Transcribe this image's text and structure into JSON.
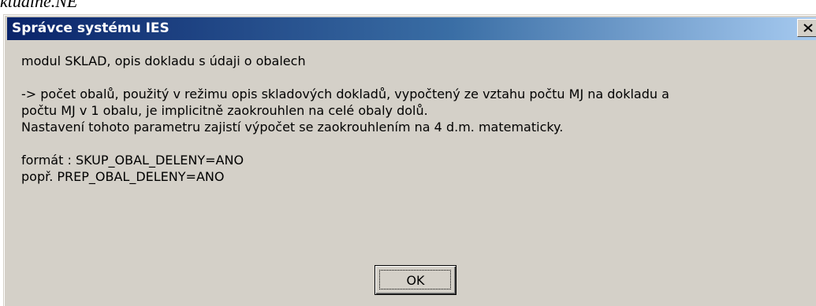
{
  "document": {
    "fragment_text": "ktualne.NE"
  },
  "dialog": {
    "title": "Správce systému IES",
    "close_icon": "close-icon",
    "message_lines": [
      "modul SKLAD, opis dokladu s údaji o obalech",
      "",
      "-> počet obalů, použitý v režimu opis skladových dokladů, vypočtený ze vztahu počtu MJ na dokladu a",
      "počtu MJ v 1 obalu, je implicitně zaokrouhlen na celé obaly dolů.",
      "Nastavení tohoto parametru zajistí výpočet se zaokrouhlením na 4 d.m. matematicky.",
      "",
      "formát : SKUP_OBAL_DELENY=ANO",
      "popř. PREP_OBAL_DELENY=ANO"
    ],
    "ok_label": "OK"
  },
  "colors": {
    "titlebar_start": "#0a246a",
    "titlebar_end": "#a6caf0",
    "dialog_face": "#d4d0c8"
  }
}
